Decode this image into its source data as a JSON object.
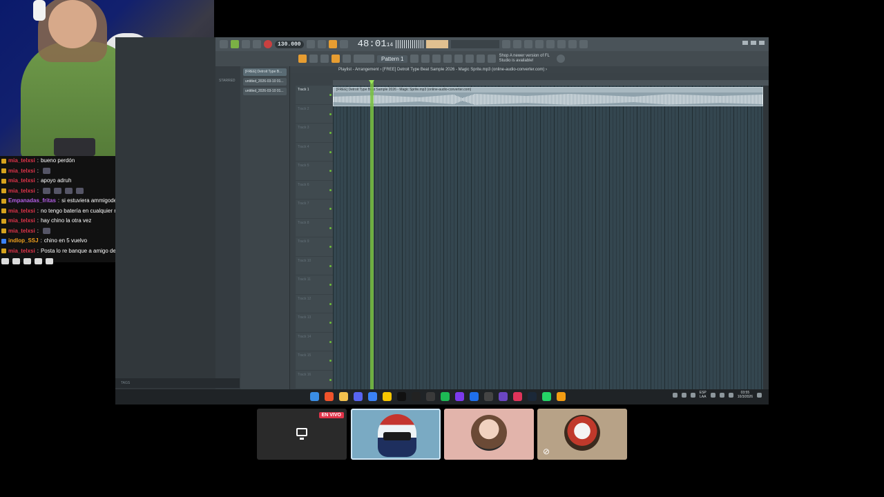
{
  "chat": {
    "messages": [
      {
        "user": "mia_telxsi",
        "user_color": "#e0344a",
        "text": "bueno perdón",
        "emotes": 0
      },
      {
        "user": "mia_telxsi",
        "user_color": "#e0344a",
        "text": "",
        "emotes": 1
      },
      {
        "user": "mia_telxsi",
        "user_color": "#e0344a",
        "text": "apoyo adruh",
        "emotes": 0
      },
      {
        "user": "mia_telxsi",
        "user_color": "#e0344a",
        "text": "",
        "emotes": 4
      },
      {
        "user": "Empanadas_fritas",
        "user_color": "#b35fe6",
        "text": "si estuviera ammigodeyutub acarrea",
        "emotes": 0
      },
      {
        "user": "mia_telxsi",
        "user_color": "#e0344a",
        "text": "no tengo batería en cualquier momento me desaparezco",
        "emotes": 0
      },
      {
        "user": "mia_telxsi",
        "user_color": "#e0344a",
        "text": "hay chino la otra vez",
        "emotes": 0
      },
      {
        "user": "mia_telxsi",
        "user_color": "#e0344a",
        "text": "",
        "emotes": 1
      },
      {
        "user": "indlop_SSJ",
        "user_color": "#f2a11d",
        "text": "chino en 5 vuelvo",
        "emotes": 0
      },
      {
        "user": "mia_telxsi",
        "user_color": "#e0344a",
        "text": "Posta lo re banque a amigo de YouTube pero bueno JSJKHJAJ",
        "emotes": 2
      }
    ]
  },
  "fl": {
    "tempo": "130.000",
    "time": "48:01",
    "time_sub": "14",
    "pattern": "Pattern 1",
    "news": "Shop  A newer version of FL Studio is available!",
    "browser_label": "STARRED",
    "channels": [
      "[FREE] Detroit Type B...",
      "untitled_2026-03-10 01...",
      "untitled_2026-03-10 01..."
    ],
    "playlist_title": "Playlist - Arrangement › [FREE] Detroit Type Beat Sample 2026 - Magic Sprite.mp3 (online-audio-converter.com) ›",
    "clip_title": "[FREE] Detroit Type Beat Sample 2026 - Magic Sprite.mp3 (online-audio-converter.com)",
    "tracks": [
      "Track 1",
      "Track 2",
      "Track 3",
      "Track 4",
      "Track 5",
      "Track 6",
      "Track 7",
      "Track 8",
      "Track 9",
      "Track 10",
      "Track 11",
      "Track 12",
      "Track 13",
      "Track 14",
      "Track 15",
      "Track 16"
    ],
    "tags_label": "TAGS"
  },
  "taskbar": {
    "icons": [
      {
        "name": "windows-start-icon",
        "color": "#3a8ee6"
      },
      {
        "name": "brave-icon",
        "color": "#f0532b"
      },
      {
        "name": "file-explorer-icon",
        "color": "#f2c14e"
      },
      {
        "name": "discord-icon",
        "color": "#5865f2"
      },
      {
        "name": "photos-icon",
        "color": "#3b82f6"
      },
      {
        "name": "norton-icon",
        "color": "#f7c600"
      },
      {
        "name": "x-icon",
        "color": "#111111"
      },
      {
        "name": "tiktok-icon",
        "color": "#222222"
      },
      {
        "name": "obs-icon",
        "color": "#3a3a3a"
      },
      {
        "name": "spotify-icon",
        "color": "#1db954"
      },
      {
        "name": "browser-icon",
        "color": "#7c3aed"
      },
      {
        "name": "edge-icon",
        "color": "#1f6feb"
      },
      {
        "name": "terminal-icon",
        "color": "#444444"
      },
      {
        "name": "settings-icon",
        "color": "#6b46c1"
      },
      {
        "name": "music-icon",
        "color": "#e0345a"
      },
      {
        "name": "steam-icon",
        "color": "#1b2838"
      },
      {
        "name": "whatsapp-icon",
        "color": "#25d366"
      },
      {
        "name": "fl-studio-icon",
        "color": "#f39c12"
      }
    ],
    "lang_top": "ESP",
    "lang_bottom": "LAA",
    "clock_time": "03:55",
    "clock_date": "10/3/2026"
  },
  "call": {
    "live_badge": "EN VIVO"
  }
}
